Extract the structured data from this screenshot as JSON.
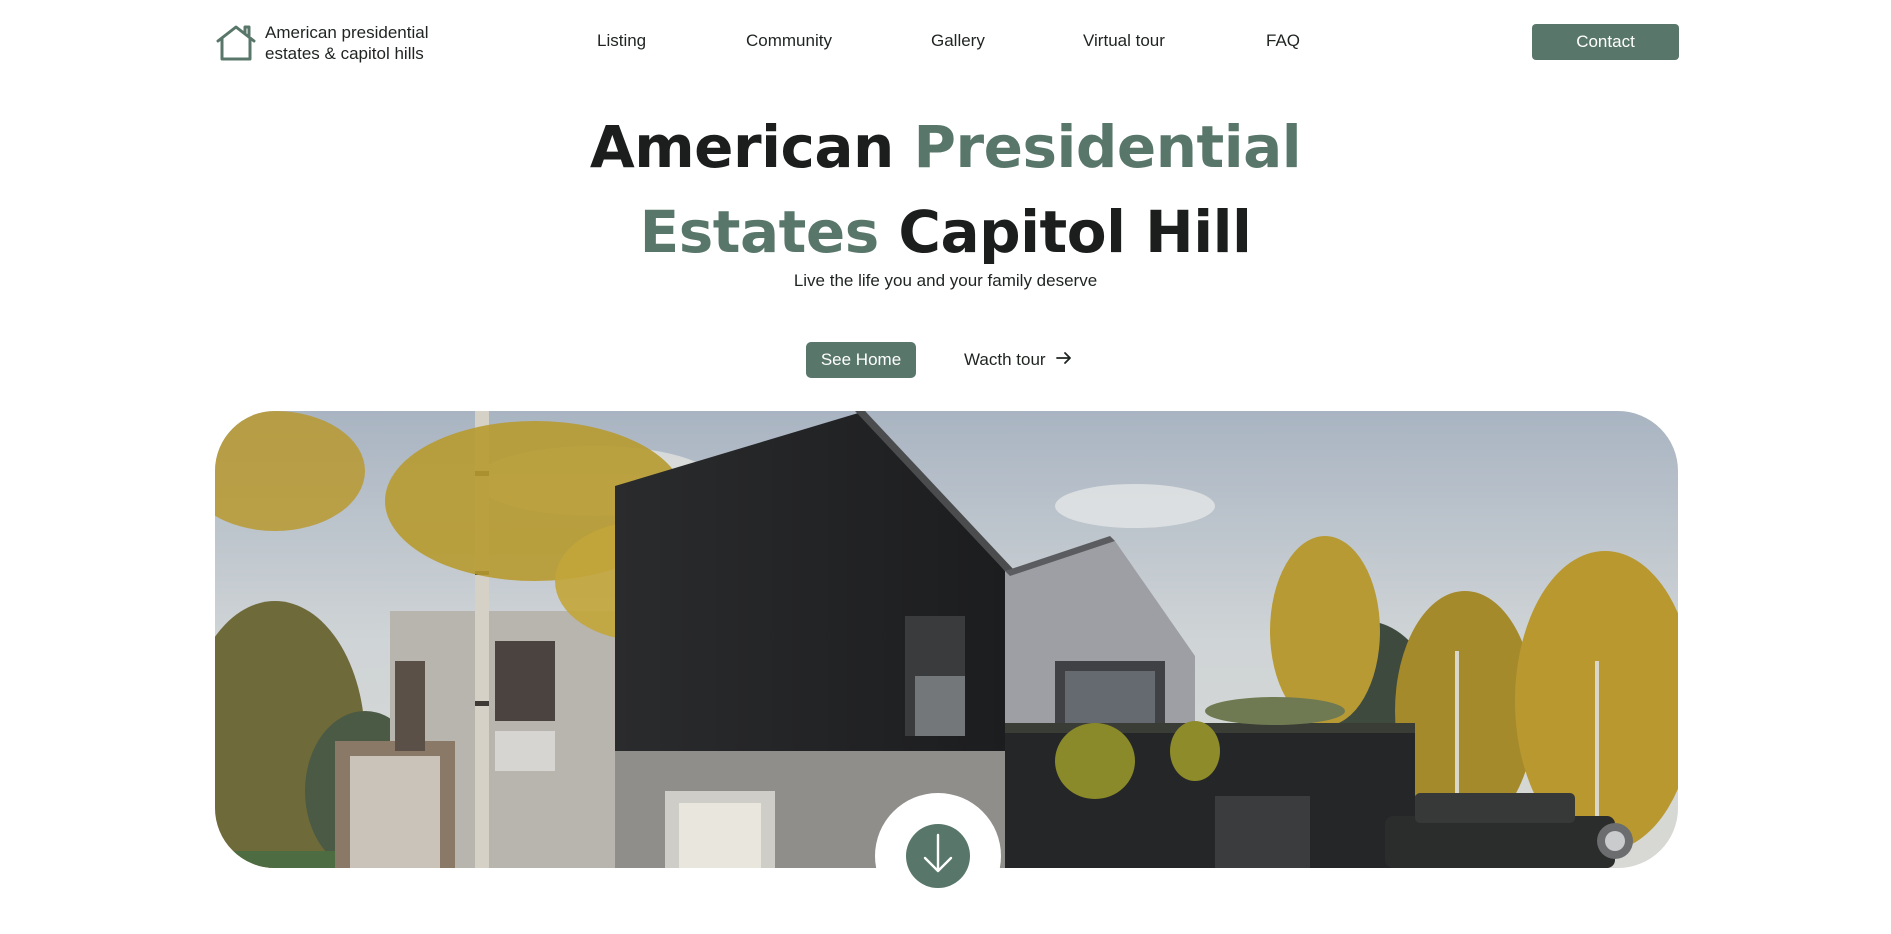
{
  "brand": {
    "name_line1": "American presidential",
    "name_line2": "estates & capitol hills",
    "icon": "house-icon"
  },
  "nav": {
    "links": [
      "Listing",
      "Community",
      "Gallery",
      "Virtual tour",
      "FAQ"
    ],
    "contact_label": "Contact"
  },
  "hero": {
    "title_part1": "American",
    "title_part2": "Presidential",
    "title_part3": "Estates",
    "title_part4": "Capitol Hill",
    "subtitle": "Live the life you and your family deserve",
    "primary_cta": "See Home",
    "secondary_cta": "Wacth tour",
    "secondary_icon": "arrow-right-icon",
    "image_alt": "modern-house-photo",
    "scroll_icon": "arrow-down-icon"
  },
  "colors": {
    "accent": "#58776a",
    "text": "#1b1e1c",
    "background": "#ffffff"
  }
}
